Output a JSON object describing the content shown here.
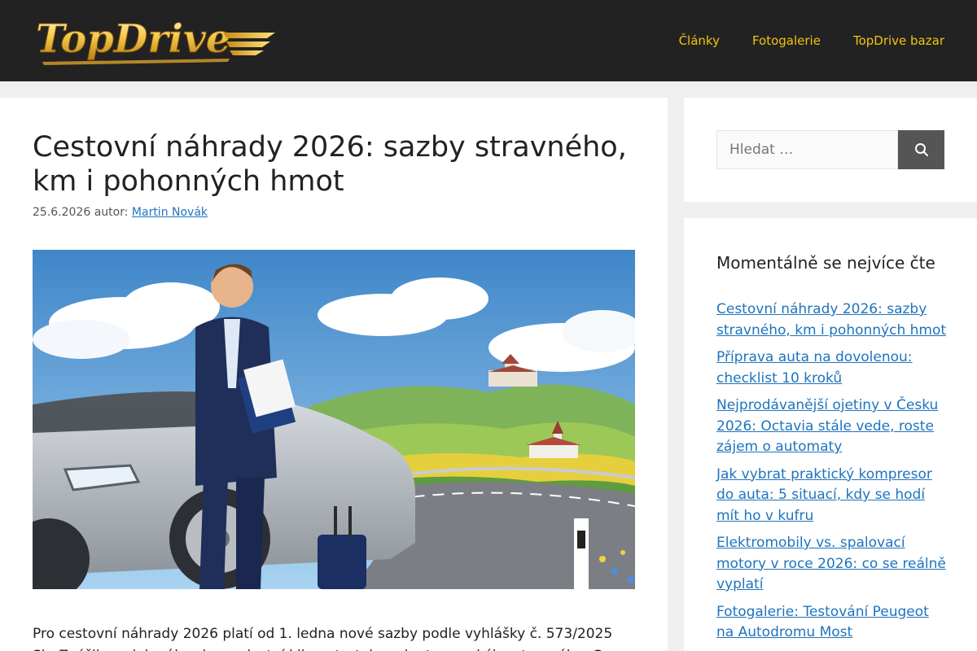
{
  "header": {
    "logo_text": "TopDrive",
    "nav": [
      {
        "label": "Články"
      },
      {
        "label": "Fotogalerie"
      },
      {
        "label": "TopDrive bazar"
      }
    ]
  },
  "article": {
    "title": "Cestovní náhrady 2026: sazby stravného, km i pohonných hmot",
    "date": "25.6.2026",
    "author_prefix": "autor:",
    "author": "Martin Novák",
    "hero_icon": "hero-illustration-businessman-car-road",
    "body": "Pro cestovní náhrady 2026 platí od 1. ledna nové sazby podle vyhlášky č. 573/2025 Sb. Zvýšily se jak náhrady za vlastní kilometr, tak sazby tuzemského stravného. Ceny"
  },
  "sidebar": {
    "search": {
      "placeholder": "Hledat …",
      "button_icon": "search-icon"
    },
    "popular": {
      "title": "Momentálně se nejvíce čte",
      "items": [
        {
          "label": "Cestovní náhrady 2026: sazby stravného, km i pohonných hmot"
        },
        {
          "label": "Příprava auta na dovolenou: checklist 10 kroků"
        },
        {
          "label": "Nejprodávanější ojetiny v Česku 2026: Octavia stále vede, roste zájem o automaty"
        },
        {
          "label": "Jak vybrat praktický kompresor do auta: 5 situací, kdy se hodí mít ho v kufru"
        },
        {
          "label": "Elektromobily vs. spalovací motory v roce 2026: co se reálně vyplatí"
        },
        {
          "label": "Fotogalerie: Testování Peugeot na Autodromu Most"
        }
      ]
    }
  },
  "colors": {
    "header_bg": "#222222",
    "nav_text": "#f1c40f",
    "link": "#1e73be",
    "search_button": "#555555"
  }
}
